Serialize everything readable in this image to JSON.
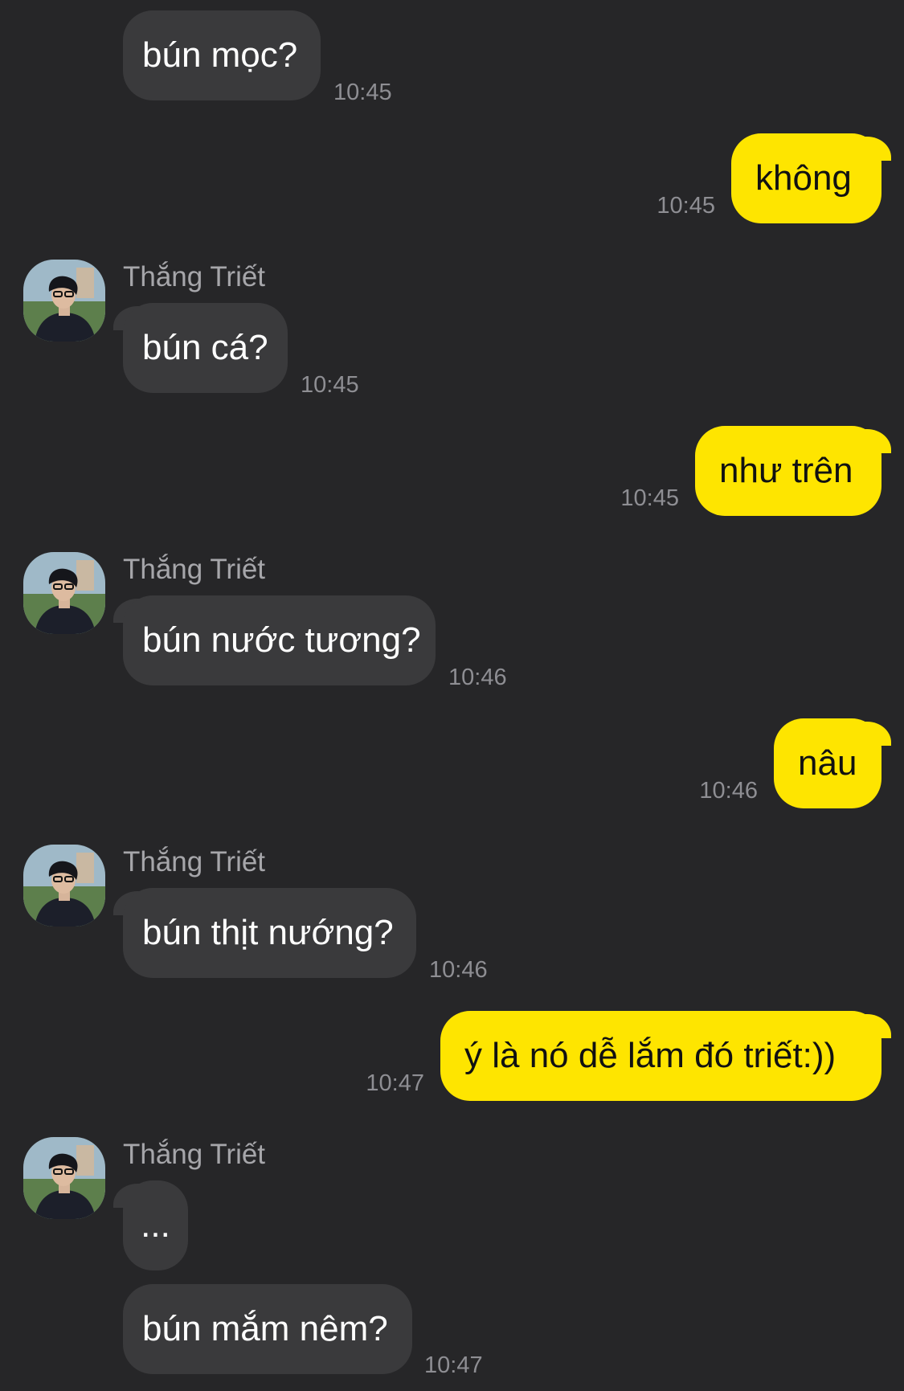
{
  "colors": {
    "background": "#262628",
    "incoming_bubble": "#3a3a3c",
    "outgoing_bubble": "#fee500",
    "timestamp": "#8e8e93",
    "sender_name": "#a6a6aa"
  },
  "messages": [
    {
      "direction": "in",
      "text": "bún mọc?",
      "time": "10:45"
    },
    {
      "direction": "out",
      "text": "không",
      "time": "10:45"
    },
    {
      "direction": "in",
      "sender": "Thắng Triết",
      "avatar_icon": "user-avatar",
      "text": "bún cá?",
      "time": "10:45"
    },
    {
      "direction": "out",
      "text": "như trên",
      "time": "10:45"
    },
    {
      "direction": "in",
      "sender": "Thắng Triết",
      "avatar_icon": "user-avatar",
      "text": "bún nước tương?",
      "time": "10:46"
    },
    {
      "direction": "out",
      "text": "nâu",
      "time": "10:46"
    },
    {
      "direction": "in",
      "sender": "Thắng Triết",
      "avatar_icon": "user-avatar",
      "text": "bún thịt nướng?",
      "time": "10:46"
    },
    {
      "direction": "out",
      "text": "ý là nó dễ lắm đó triết:))",
      "time": "10:47"
    },
    {
      "direction": "in",
      "sender": "Thắng Triết",
      "avatar_icon": "user-avatar",
      "text": "...",
      "time": ""
    },
    {
      "direction": "in",
      "text": "bún mắm nêm?",
      "time": "10:47"
    }
  ]
}
